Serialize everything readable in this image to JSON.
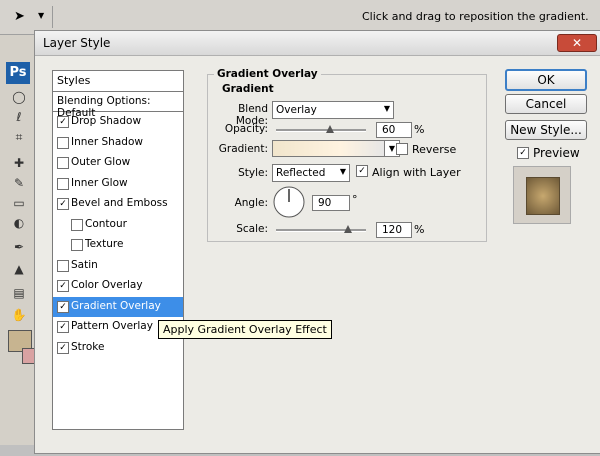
{
  "optbar": {
    "hint": "Click and drag to reposition the gradient."
  },
  "toolbar": {
    "logo": "Ps"
  },
  "dialog": {
    "title": "Layer Style",
    "styles_header": "Styles",
    "blending_options": "Blending Options: Default",
    "items": [
      {
        "label": "Drop Shadow",
        "checked": true
      },
      {
        "label": "Inner Shadow",
        "checked": false
      },
      {
        "label": "Outer Glow",
        "checked": false
      },
      {
        "label": "Inner Glow",
        "checked": false
      },
      {
        "label": "Bevel and Emboss",
        "checked": true
      },
      {
        "label": "Contour",
        "checked": false
      },
      {
        "label": "Texture",
        "checked": false
      },
      {
        "label": "Satin",
        "checked": false
      },
      {
        "label": "Color Overlay",
        "checked": true
      },
      {
        "label": "Gradient Overlay",
        "checked": true,
        "selected": true
      },
      {
        "label": "Pattern Overlay",
        "checked": true
      },
      {
        "label": "Stroke",
        "checked": true
      }
    ],
    "group_title": "Gradient Overlay",
    "sub_title": "Gradient",
    "blend_mode_label": "Blend Mode:",
    "blend_mode_value": "Overlay",
    "opacity_label": "Opacity:",
    "opacity_value": "60",
    "opacity_unit": "%",
    "gradient_label": "Gradient:",
    "reverse_label": "Reverse",
    "style_label": "Style:",
    "style_value": "Reflected",
    "align_label": "Align with Layer",
    "angle_label": "Angle:",
    "angle_value": "90",
    "angle_unit": "°",
    "scale_label": "Scale:",
    "scale_value": "120",
    "scale_unit": "%",
    "ok": "OK",
    "cancel": "Cancel",
    "new_style": "New Style...",
    "preview": "Preview",
    "tooltip": "Apply Gradient Overlay Effect"
  }
}
